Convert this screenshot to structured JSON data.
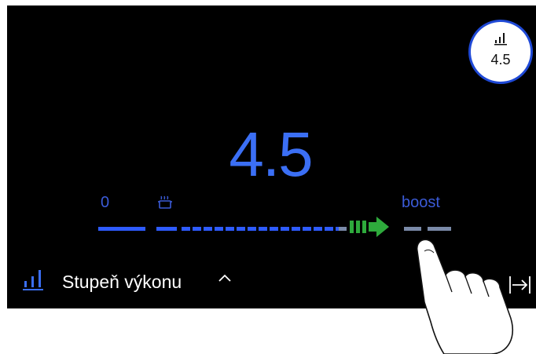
{
  "zone_badge": {
    "icon": "power-level-icon",
    "value": "4.5"
  },
  "power_level": {
    "value": "4.5",
    "max_label": "boost",
    "min_label": "0",
    "current_fraction": 0.69
  },
  "scale": {
    "min_label": "0",
    "max_label": "boost",
    "mid_icon": "pot-steam-icon"
  },
  "footer": {
    "label": "Stupeň výkonu",
    "expand_icon": "chevron-up-icon",
    "left_icon": "power-level-icon",
    "right_icon": "collapse-panel-icon"
  },
  "colors": {
    "accent": "#3b6ff5",
    "track_active": "#2e5bff",
    "track_inactive": "#7a8aa8",
    "boost_arrow": "#2eaa3c",
    "background": "#000000"
  }
}
